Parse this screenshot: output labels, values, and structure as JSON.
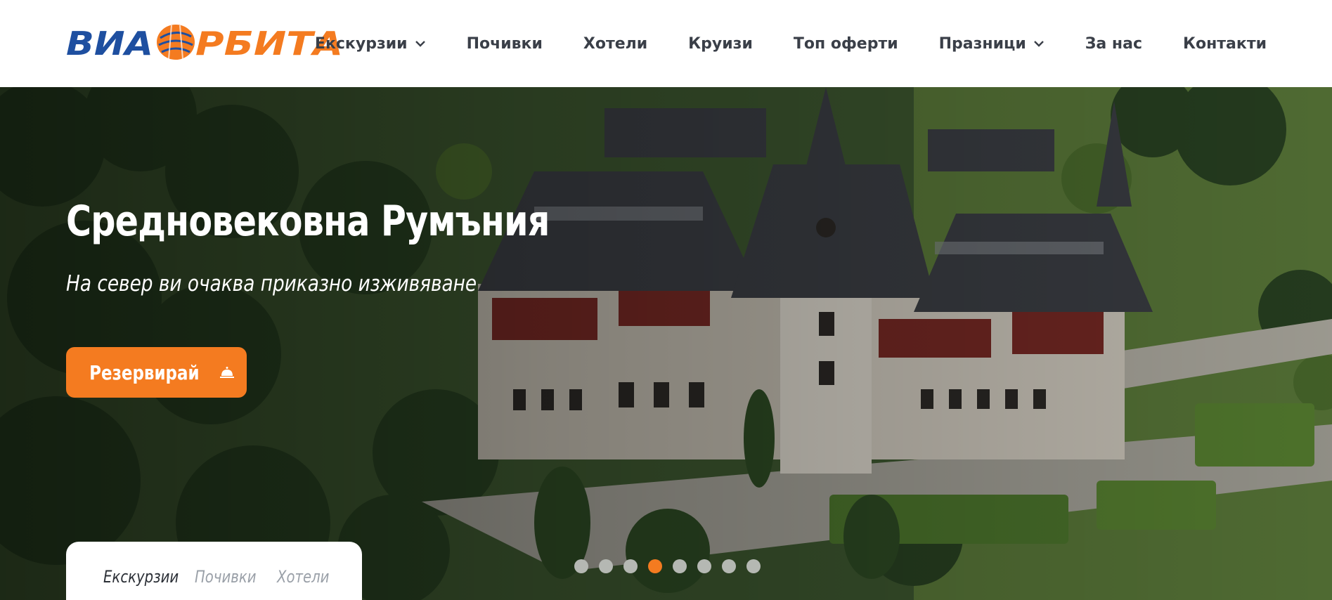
{
  "logo": {
    "text_left": "ВИА",
    "text_right": "РБИТА",
    "colors": {
      "blue": "#1e4fa0",
      "orange": "#f47b20"
    }
  },
  "nav": {
    "items": [
      {
        "label": "Екскурзии",
        "dropdown": true
      },
      {
        "label": "Почивки",
        "dropdown": false
      },
      {
        "label": "Хотели",
        "dropdown": false
      },
      {
        "label": "Круизи",
        "dropdown": false
      },
      {
        "label": "Топ оферти",
        "dropdown": false
      },
      {
        "label": "Празници",
        "dropdown": true
      },
      {
        "label": "За нас",
        "dropdown": false
      },
      {
        "label": "Контакти",
        "dropdown": false
      }
    ]
  },
  "hero": {
    "title": "Средновековна Румъния",
    "subtitle": "На север ви очаква приказно изживяване",
    "button": {
      "label": "Резервирай",
      "icon": "bell-icon"
    },
    "slider": {
      "count": 8,
      "active_index": 3
    }
  },
  "search_tabs": {
    "items": [
      {
        "label": "Екскурзии",
        "active": true
      },
      {
        "label": "Почивки",
        "active": false
      },
      {
        "label": "Хотели",
        "active": false
      }
    ]
  },
  "colors": {
    "accent": "#f47b20",
    "nav_text": "#3a3f48"
  }
}
